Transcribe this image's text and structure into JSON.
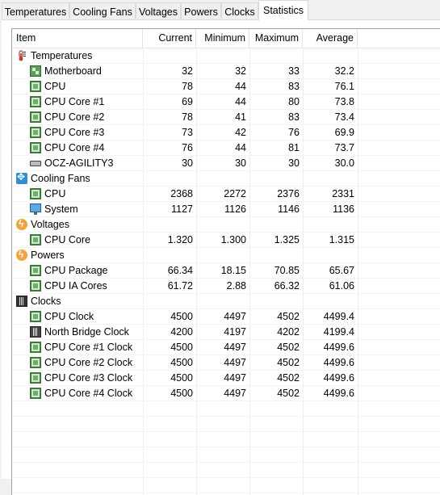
{
  "tabs": [
    {
      "label": "Temperatures",
      "active": false
    },
    {
      "label": "Cooling Fans",
      "active": false
    },
    {
      "label": "Voltages",
      "active": false
    },
    {
      "label": "Powers",
      "active": false
    },
    {
      "label": "Clocks",
      "active": false
    },
    {
      "label": "Statistics",
      "active": true
    }
  ],
  "columns": {
    "item": "Item",
    "current": "Current",
    "minimum": "Minimum",
    "maximum": "Maximum",
    "average": "Average"
  },
  "rows": [
    {
      "kind": "group",
      "icon": "thermometer-icon",
      "name": "Temperatures"
    },
    {
      "kind": "item",
      "icon": "motherboard-icon",
      "name": "Motherboard",
      "current": "32",
      "minimum": "32",
      "maximum": "33",
      "average": "32.2"
    },
    {
      "kind": "item",
      "icon": "chip-icon",
      "name": "CPU",
      "current": "78",
      "minimum": "44",
      "maximum": "83",
      "average": "76.1"
    },
    {
      "kind": "item",
      "icon": "chip-icon",
      "name": "CPU Core #1",
      "current": "69",
      "minimum": "44",
      "maximum": "80",
      "average": "73.8"
    },
    {
      "kind": "item",
      "icon": "chip-icon",
      "name": "CPU Core #2",
      "current": "78",
      "minimum": "41",
      "maximum": "83",
      "average": "73.4"
    },
    {
      "kind": "item",
      "icon": "chip-icon",
      "name": "CPU Core #3",
      "current": "73",
      "minimum": "42",
      "maximum": "76",
      "average": "69.9"
    },
    {
      "kind": "item",
      "icon": "chip-icon",
      "name": "CPU Core #4",
      "current": "76",
      "minimum": "44",
      "maximum": "81",
      "average": "73.7"
    },
    {
      "kind": "item",
      "icon": "disk-icon",
      "name": "OCZ-AGILITY3",
      "current": "30",
      "minimum": "30",
      "maximum": "30",
      "average": "30.0"
    },
    {
      "kind": "group",
      "icon": "fan-icon",
      "name": "Cooling Fans"
    },
    {
      "kind": "item",
      "icon": "chip-icon",
      "name": "CPU",
      "current": "2368",
      "minimum": "2272",
      "maximum": "2376",
      "average": "2331"
    },
    {
      "kind": "item",
      "icon": "monitor-icon",
      "name": "System",
      "current": "1127",
      "minimum": "1126",
      "maximum": "1146",
      "average": "1136"
    },
    {
      "kind": "group",
      "icon": "voltage-icon",
      "name": "Voltages"
    },
    {
      "kind": "item",
      "icon": "chip-icon",
      "name": "CPU Core",
      "current": "1.320",
      "minimum": "1.300",
      "maximum": "1.325",
      "average": "1.315"
    },
    {
      "kind": "group",
      "icon": "power-icon",
      "name": "Powers"
    },
    {
      "kind": "item",
      "icon": "chip-icon",
      "name": "CPU Package",
      "current": "66.34",
      "minimum": "18.15",
      "maximum": "70.85",
      "average": "65.67"
    },
    {
      "kind": "item",
      "icon": "chip-icon",
      "name": "CPU IA Cores",
      "current": "61.72",
      "minimum": "2.88",
      "maximum": "66.32",
      "average": "61.06"
    },
    {
      "kind": "group",
      "icon": "clocks-icon",
      "name": "Clocks"
    },
    {
      "kind": "item",
      "icon": "chip-icon",
      "name": "CPU Clock",
      "current": "4500",
      "minimum": "4497",
      "maximum": "4502",
      "average": "4499.4"
    },
    {
      "kind": "item",
      "icon": "northbridge-icon",
      "name": "North Bridge Clock",
      "current": "4200",
      "minimum": "4197",
      "maximum": "4202",
      "average": "4199.4"
    },
    {
      "kind": "item",
      "icon": "chip-icon",
      "name": "CPU Core #1 Clock",
      "current": "4500",
      "minimum": "4497",
      "maximum": "4502",
      "average": "4499.6"
    },
    {
      "kind": "item",
      "icon": "chip-icon",
      "name": "CPU Core #2 Clock",
      "current": "4500",
      "minimum": "4497",
      "maximum": "4502",
      "average": "4499.6"
    },
    {
      "kind": "item",
      "icon": "chip-icon",
      "name": "CPU Core #3 Clock",
      "current": "4500",
      "minimum": "4497",
      "maximum": "4502",
      "average": "4499.6"
    },
    {
      "kind": "item",
      "icon": "chip-icon",
      "name": "CPU Core #4 Clock",
      "current": "4500",
      "minimum": "4497",
      "maximum": "4502",
      "average": "4499.6"
    }
  ]
}
